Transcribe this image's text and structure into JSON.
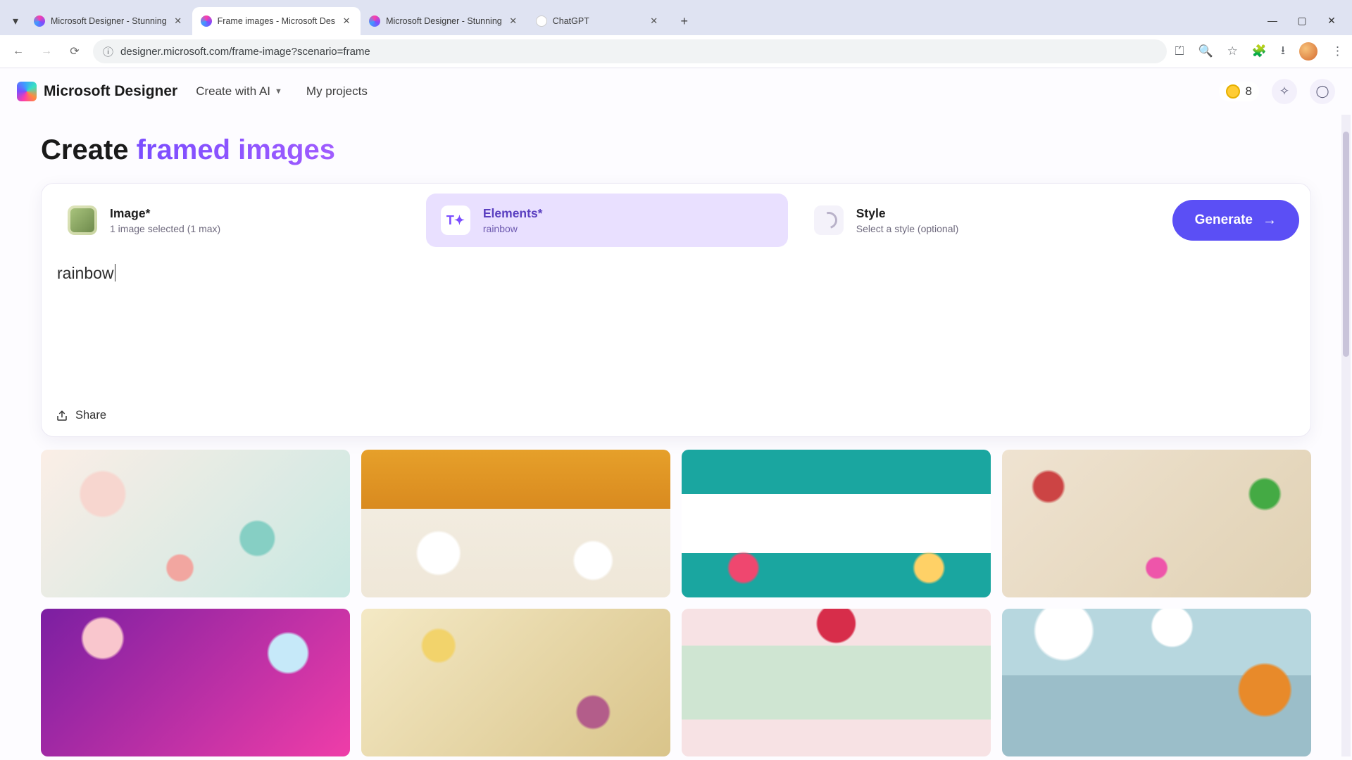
{
  "browser": {
    "tabs": [
      {
        "title": "Microsoft Designer - Stunning"
      },
      {
        "title": "Frame images - Microsoft Des"
      },
      {
        "title": "Microsoft Designer - Stunning"
      },
      {
        "title": "ChatGPT"
      }
    ],
    "active_tab_index": 1,
    "url": "designer.microsoft.com/frame-image?scenario=frame"
  },
  "app_header": {
    "brand": "Microsoft Designer",
    "menu": {
      "create_label": "Create with AI",
      "projects_label": "My projects"
    },
    "coins": "8"
  },
  "page": {
    "title_prefix": "Create ",
    "title_accent": "framed images"
  },
  "cards": {
    "image": {
      "label": "Image*",
      "sub": "1 image selected (1 max)"
    },
    "elements": {
      "label": "Elements*",
      "sub": "rainbow",
      "thumb_text": "T✦"
    },
    "style": {
      "label": "Style",
      "sub": "Select a style (optional)"
    }
  },
  "generate_label": "Generate",
  "prompt_value": "rainbow",
  "share_label": "Share"
}
